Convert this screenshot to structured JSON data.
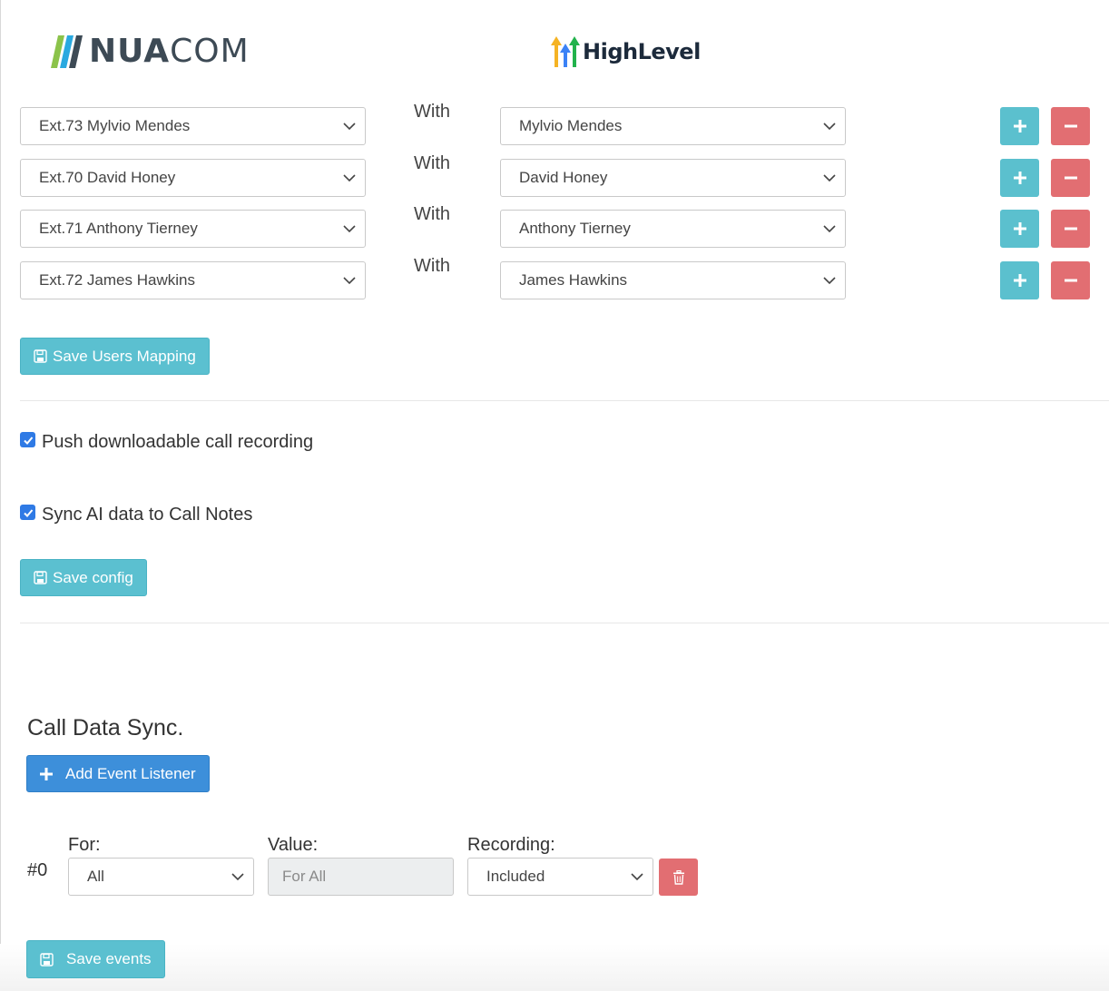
{
  "brands": {
    "left_logo": {
      "text_bold": "NUA",
      "text_light": "COM",
      "icon": "nuacom-stripes-icon"
    },
    "right_logo": {
      "text": "HighLevel",
      "icon": "highlevel-arrows-icon"
    }
  },
  "mapping": {
    "with_label": "With",
    "rows": [
      {
        "extension": "Ext.73 Mylvio Mendes",
        "user": "Mylvio Mendes"
      },
      {
        "extension": "Ext.70 David Honey",
        "user": "David Honey"
      },
      {
        "extension": "Ext.71 Anthony Tierney",
        "user": "Anthony Tierney"
      },
      {
        "extension": "Ext.72 James Hawkins",
        "user": "James Hawkins"
      }
    ],
    "save_label": "Save Users Mapping"
  },
  "config": {
    "push_recording_label": "Push downloadable call recording",
    "push_recording_checked": true,
    "sync_ai_label": "Sync AI data to Call Notes",
    "sync_ai_checked": true,
    "save_label": "Save config"
  },
  "call_data_sync": {
    "title": "Call Data Sync.",
    "add_label": "Add Event Listener",
    "events": [
      {
        "index": "#0",
        "for_label": "For:",
        "for_value": "All",
        "value_label": "Value:",
        "value_placeholder": "For All",
        "recording_label": "Recording:",
        "recording_value": "Included"
      }
    ],
    "save_label": "Save events"
  },
  "colors": {
    "info": "#5bc0d0",
    "danger": "#e26e72",
    "primary": "#3d8fda",
    "checkbox": "#2f7ae5"
  }
}
